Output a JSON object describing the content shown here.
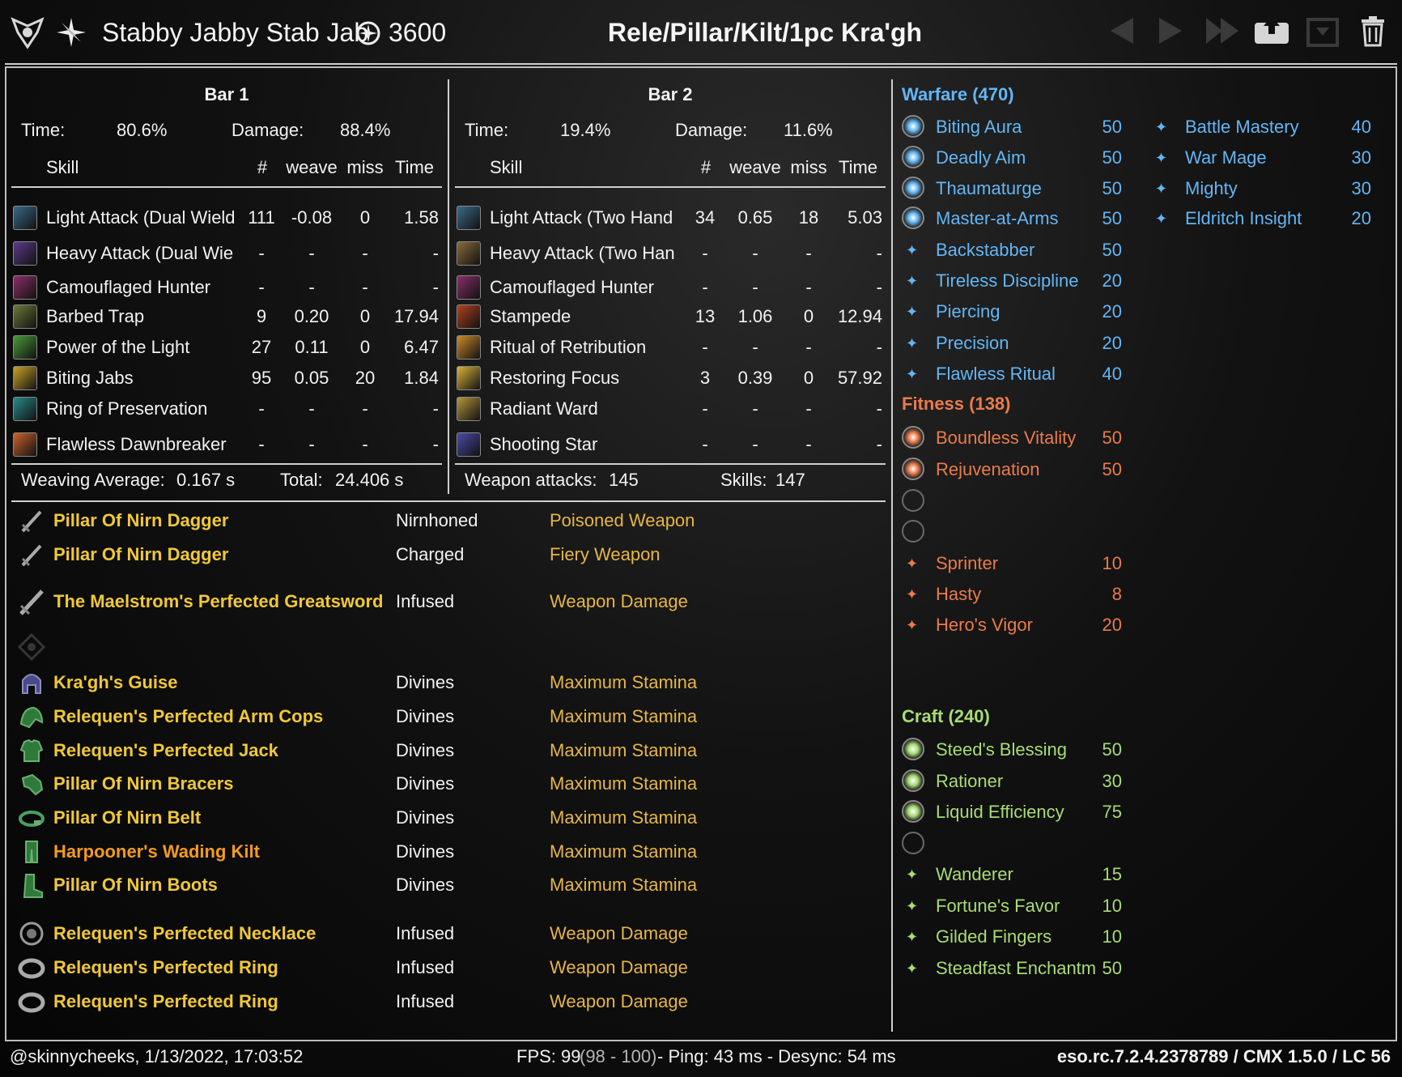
{
  "header": {
    "character_name": "Stabby Jabby Stab Jab",
    "cp_total": "3600",
    "fight_title": "Rele/Pillar/Kilt/1pc Kra'gh"
  },
  "bar1": {
    "title": "Bar 1",
    "time_label": "Time:",
    "time_value": "80.6%",
    "damage_label": "Damage:",
    "damage_value": "88.4%",
    "columns": [
      "Skill",
      "#",
      "weave",
      "miss",
      "Time"
    ],
    "skills": [
      {
        "name": "Light Attack (Dual Wield",
        "count": "111",
        "weave": "-0.08",
        "miss": "0",
        "time": "1.58",
        "icon_color": "#3b6a8a"
      },
      {
        "name": "Heavy Attack (Dual Wie",
        "count": "-",
        "weave": "-",
        "miss": "-",
        "time": "-",
        "icon_color": "#5b3a8a"
      },
      {
        "name": "Camouflaged Hunter",
        "count": "-",
        "weave": "-",
        "miss": "-",
        "time": "-",
        "icon_color": "#8a2f6a"
      },
      {
        "name": "Barbed Trap",
        "count": "9",
        "weave": "0.20",
        "miss": "0",
        "time": "17.94",
        "icon_color": "#6a7a3a"
      },
      {
        "name": "Power of the Light",
        "count": "27",
        "weave": "0.11",
        "miss": "0",
        "time": "6.47",
        "icon_color": "#4a9a3a"
      },
      {
        "name": "Biting Jabs",
        "count": "95",
        "weave": "0.05",
        "miss": "20",
        "time": "1.84",
        "icon_color": "#c9a22a"
      },
      {
        "name": "Ring of Preservation",
        "count": "-",
        "weave": "-",
        "miss": "-",
        "time": "-",
        "icon_color": "#2a8a8a"
      },
      {
        "name": "Flawless Dawnbreaker",
        "count": "-",
        "weave": "-",
        "miss": "-",
        "time": "-",
        "icon_color": "#c9622a"
      }
    ],
    "footer_label1": "Weaving Average:",
    "footer_value1": "0.167 s",
    "footer_label2": "Total:",
    "footer_value2": "24.406 s"
  },
  "bar2": {
    "title": "Bar 2",
    "time_label": "Time:",
    "time_value": "19.4%",
    "damage_label": "Damage:",
    "damage_value": "11.6%",
    "columns": [
      "Skill",
      "#",
      "weave",
      "miss",
      "Time"
    ],
    "skills": [
      {
        "name": "Light Attack (Two Hand",
        "count": "34",
        "weave": "0.65",
        "miss": "18",
        "time": "5.03",
        "icon_color": "#3b6a8a"
      },
      {
        "name": "Heavy Attack (Two Han",
        "count": "-",
        "weave": "-",
        "miss": "-",
        "time": "-",
        "icon_color": "#8a6a3a"
      },
      {
        "name": "Camouflaged Hunter",
        "count": "-",
        "weave": "-",
        "miss": "-",
        "time": "-",
        "icon_color": "#8a2f6a"
      },
      {
        "name": "Stampede",
        "count": "13",
        "weave": "1.06",
        "miss": "0",
        "time": "12.94",
        "icon_color": "#b0421e"
      },
      {
        "name": "Ritual of Retribution",
        "count": "-",
        "weave": "-",
        "miss": "-",
        "time": "-",
        "icon_color": "#c98a2a"
      },
      {
        "name": "Restoring Focus",
        "count": "3",
        "weave": "0.39",
        "miss": "0",
        "time": "57.92",
        "icon_color": "#d9b23a"
      },
      {
        "name": "Radiant Ward",
        "count": "-",
        "weave": "-",
        "miss": "-",
        "time": "-",
        "icon_color": "#b5953a"
      },
      {
        "name": "Shooting Star",
        "count": "-",
        "weave": "-",
        "miss": "-",
        "time": "-",
        "icon_color": "#4a4aaa"
      }
    ],
    "footer_label1": "Weapon attacks:",
    "footer_value1": "145",
    "footer_label2": "Skills:",
    "footer_value2": "147"
  },
  "gear": [
    {
      "name": "Pillar Of Nirn Dagger",
      "trait": "Nirnhoned",
      "enchant": "Poisoned Weapon",
      "icon": "dagger-icon",
      "color": "#f1c836"
    },
    {
      "name": "Pillar Of Nirn Dagger",
      "trait": "Charged",
      "enchant": "Fiery Weapon",
      "icon": "dagger-icon",
      "color": "#f1c836"
    },
    {
      "name": "The Maelstrom's Perfected Greatsword",
      "trait": "Infused",
      "enchant": "Weapon Damage",
      "icon": "greatsword-icon",
      "color": "#f1c836"
    },
    {
      "name": "Kra'gh's Guise",
      "trait": "Divines",
      "enchant": "Maximum Stamina",
      "icon": "helmet-icon",
      "color": "#f1c836"
    },
    {
      "name": "Relequen's Perfected Arm Cops",
      "trait": "Divines",
      "enchant": "Maximum Stamina",
      "icon": "shoulder-icon",
      "color": "#f1c836"
    },
    {
      "name": "Relequen's Perfected Jack",
      "trait": "Divines",
      "enchant": "Maximum Stamina",
      "icon": "chest-icon",
      "color": "#f1c836"
    },
    {
      "name": "Pillar Of Nirn Bracers",
      "trait": "Divines",
      "enchant": "Maximum Stamina",
      "icon": "gloves-icon",
      "color": "#f1c836"
    },
    {
      "name": "Pillar Of Nirn Belt",
      "trait": "Divines",
      "enchant": "Maximum Stamina",
      "icon": "belt-icon",
      "color": "#f1c836"
    },
    {
      "name": "Harpooner's Wading Kilt",
      "trait": "Divines",
      "enchant": "Maximum Stamina",
      "icon": "legs-icon",
      "color": "#f49a1e"
    },
    {
      "name": "Pillar Of Nirn Boots",
      "trait": "Divines",
      "enchant": "Maximum Stamina",
      "icon": "boots-icon",
      "color": "#f1c836"
    },
    {
      "name": "Relequen's Perfected Necklace",
      "trait": "Infused",
      "enchant": "Weapon Damage",
      "icon": "necklace-icon",
      "color": "#f1c836"
    },
    {
      "name": "Relequen's Perfected Ring",
      "trait": "Infused",
      "enchant": "Weapon Damage",
      "icon": "ring-icon",
      "color": "#f1c836"
    },
    {
      "name": "Relequen's Perfected Ring",
      "trait": "Infused",
      "enchant": "Weapon Damage",
      "icon": "ring-icon",
      "color": "#f1c836"
    }
  ],
  "champion": {
    "warfare": {
      "title": "Warfare (470)",
      "color": "#63b6f5",
      "slotted": [
        {
          "name": "Biting Aura",
          "value": "50"
        },
        {
          "name": "Deadly Aim",
          "value": "50"
        },
        {
          "name": "Thaumaturge",
          "value": "50"
        },
        {
          "name": "Master-at-Arms",
          "value": "50"
        }
      ],
      "passive": [
        {
          "name": "Backstabber",
          "value": "50"
        },
        {
          "name": "Tireless Discipline",
          "value": "20"
        },
        {
          "name": "Piercing",
          "value": "20"
        },
        {
          "name": "Precision",
          "value": "20"
        },
        {
          "name": "Flawless Ritual",
          "value": "40"
        }
      ],
      "extra": [
        {
          "name": "Battle Mastery",
          "value": "40"
        },
        {
          "name": "War Mage",
          "value": "30"
        },
        {
          "name": "Mighty",
          "value": "30"
        },
        {
          "name": "Eldritch Insight",
          "value": "20"
        }
      ]
    },
    "fitness": {
      "title": "Fitness (138)",
      "color": "#ea7b4a",
      "slotted": [
        {
          "name": "Boundless Vitality",
          "value": "50"
        },
        {
          "name": "Rejuvenation",
          "value": "50"
        }
      ],
      "passive": [
        {
          "name": "Sprinter",
          "value": "10"
        },
        {
          "name": "Hasty",
          "value": "8"
        },
        {
          "name": "Hero's Vigor",
          "value": "20"
        }
      ]
    },
    "craft": {
      "title": "Craft (240)",
      "color": "#a8dc74",
      "slotted": [
        {
          "name": "Steed's Blessing",
          "value": "50"
        },
        {
          "name": "Rationer",
          "value": "30"
        },
        {
          "name": "Liquid Efficiency",
          "value": "75"
        }
      ],
      "passive": [
        {
          "name": "Wanderer",
          "value": "15"
        },
        {
          "name": "Fortune's Favor",
          "value": "10"
        },
        {
          "name": "Gilded Fingers",
          "value": "10"
        },
        {
          "name": "Steadfast Enchantm",
          "value": "50"
        }
      ]
    }
  },
  "footer": {
    "user_time": "@skinnycheeks, 1/13/2022, 17:03:52",
    "fps_label": "FPS: 99",
    "fps_range": "(98 - 100)",
    "ping": "- Ping: 43 ms - Desync: 54 ms",
    "version": "eso.rc.7.2.4.2378789 / CMX 1.5.0 / LC 56"
  }
}
